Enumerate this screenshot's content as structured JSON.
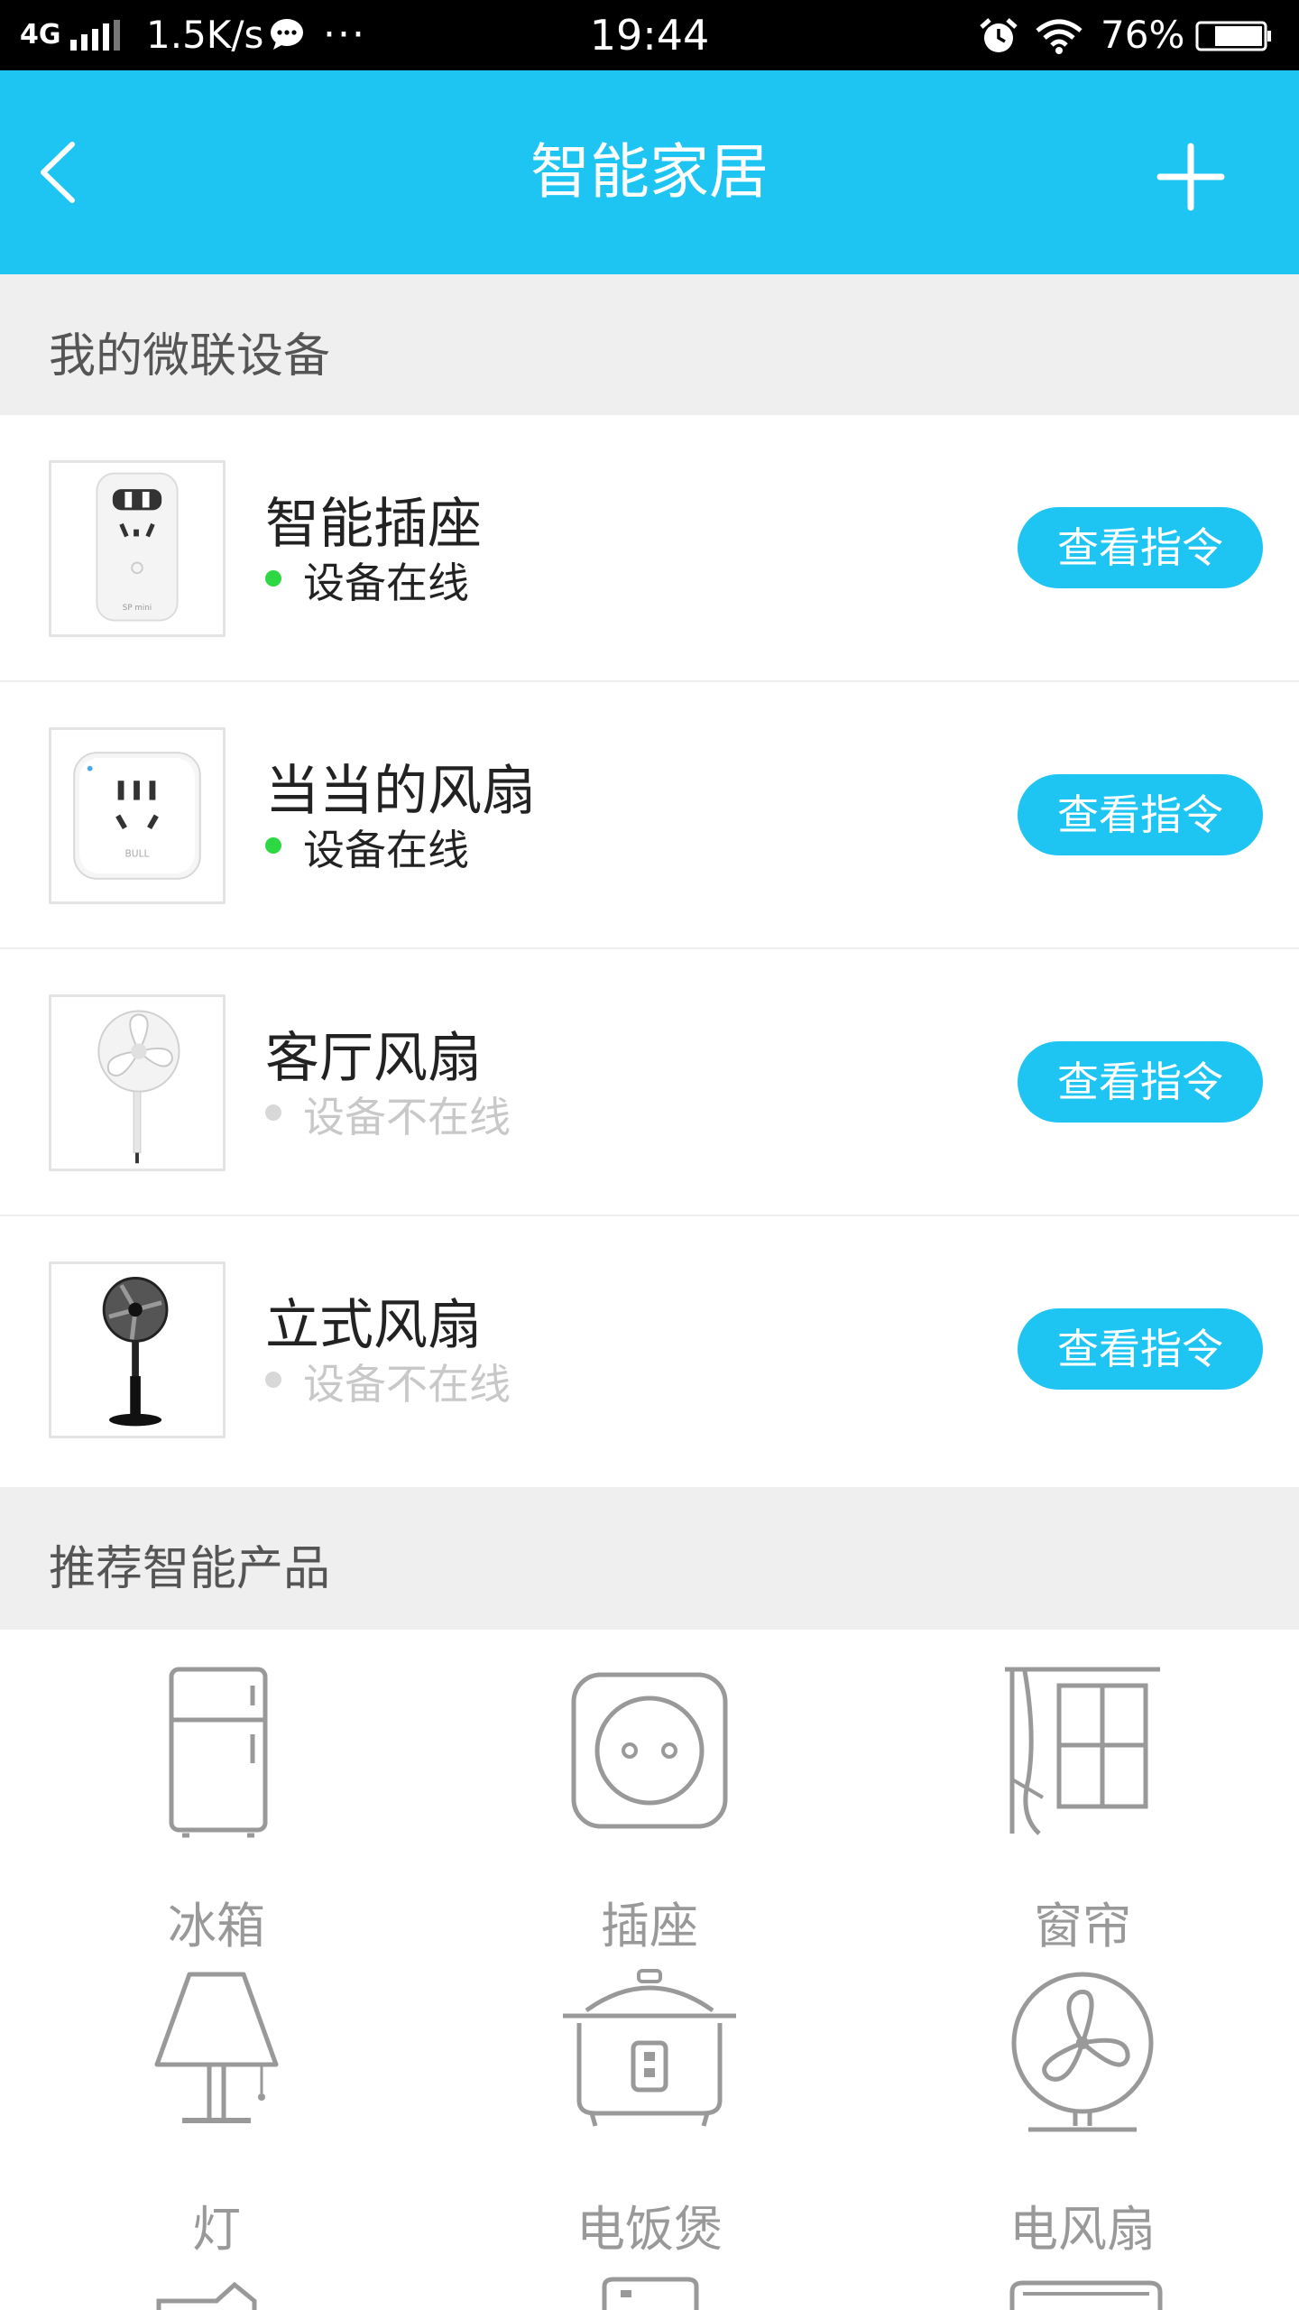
{
  "status_bar": {
    "network": "4G",
    "speed": "1.5K/s",
    "more": "···",
    "time": "19:44",
    "battery": "76%"
  },
  "header": {
    "title": "智能家居",
    "back_icon": "chevron-left-icon",
    "add_icon": "plus-icon"
  },
  "my_devices": {
    "section_title": "我的微联设备",
    "items": [
      {
        "name": "智能插座",
        "status": "设备在线",
        "online": true,
        "button": "查看指令",
        "image": "smart-plug-image"
      },
      {
        "name": "当当的风扇",
        "status": "设备在线",
        "online": true,
        "button": "查看指令",
        "image": "smart-socket-image"
      },
      {
        "name": "客厅风扇",
        "status": "设备不在线",
        "online": false,
        "button": "查看指令",
        "image": "white-fan-image"
      },
      {
        "name": "立式风扇",
        "status": "设备不在线",
        "online": false,
        "button": "查看指令",
        "image": "black-fan-image"
      }
    ]
  },
  "recommended": {
    "section_title": "推荐智能产品",
    "items": [
      {
        "label": "冰箱",
        "icon": "fridge-icon"
      },
      {
        "label": "插座",
        "icon": "socket-icon"
      },
      {
        "label": "窗帘",
        "icon": "curtain-icon"
      },
      {
        "label": "灯",
        "icon": "lamp-icon"
      },
      {
        "label": "电饭煲",
        "icon": "rice-cooker-icon"
      },
      {
        "label": "电风扇",
        "icon": "fan-icon"
      }
    ]
  },
  "colors": {
    "accent": "#1ec5f2",
    "online": "#2ed843",
    "offline": "#d8d8d8",
    "section_bg": "#efefef"
  }
}
